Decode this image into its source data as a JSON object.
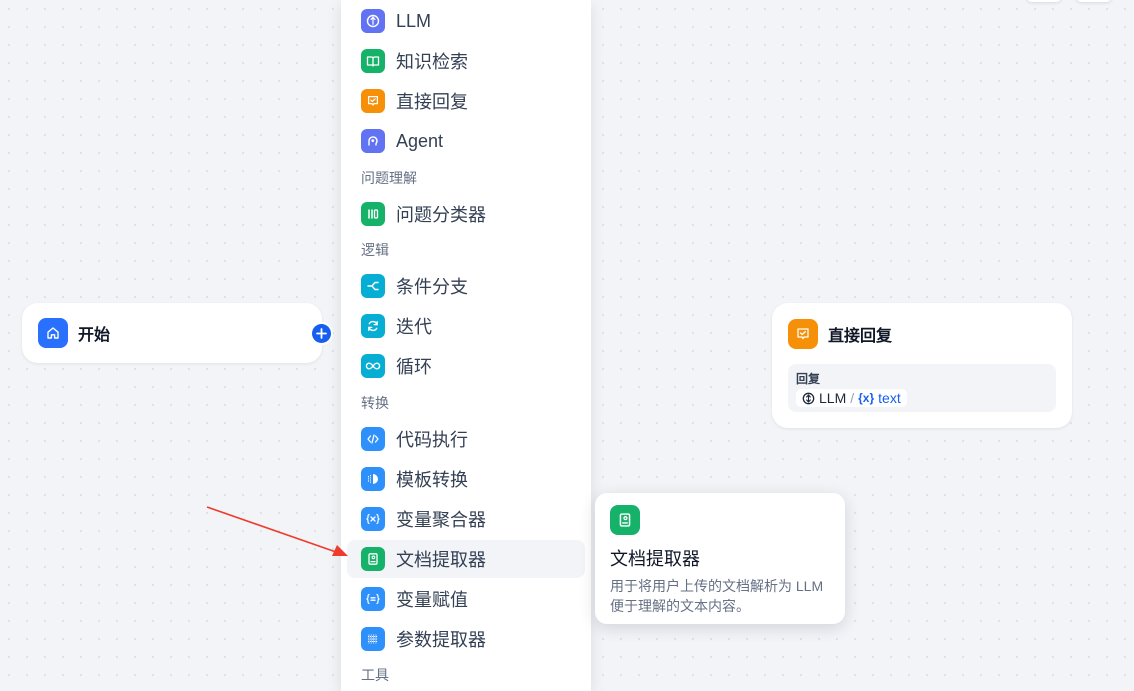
{
  "start_node": {
    "title": "开始",
    "icon": "home-icon",
    "color": "#2970ff"
  },
  "answer_node": {
    "title": "直接回复",
    "icon": "chat-check-icon",
    "color": "#f79009",
    "field_label": "回复",
    "var_source": "LLM",
    "var_separator": "/",
    "var_brace": "{x}",
    "var_name": "text"
  },
  "block_menu": {
    "items_top": [
      {
        "label": "LLM",
        "icon": "llm-icon",
        "color": "#6172f3"
      },
      {
        "label": "知识检索",
        "icon": "book-icon",
        "color": "#17b26a"
      },
      {
        "label": "直接回复",
        "icon": "chat-check-icon",
        "color": "#f79009"
      },
      {
        "label": "Agent",
        "icon": "agent-icon",
        "color": "#6172f3"
      }
    ],
    "group_question": "问题理解",
    "items_question": [
      {
        "label": "问题分类器",
        "icon": "classifier-icon",
        "color": "#17b26a"
      }
    ],
    "group_logic": "逻辑",
    "items_logic": [
      {
        "label": "条件分支",
        "icon": "branch-icon",
        "color": "#06aed4"
      },
      {
        "label": "迭代",
        "icon": "iteration-icon",
        "color": "#06aed4"
      },
      {
        "label": "循环",
        "icon": "loop-icon",
        "color": "#06aed4"
      }
    ],
    "group_transform": "转换",
    "items_transform": [
      {
        "label": "代码执行",
        "icon": "code-icon",
        "color": "#2e90fa"
      },
      {
        "label": "模板转换",
        "icon": "template-icon",
        "color": "#2e90fa"
      },
      {
        "label": "变量聚合器",
        "icon": "variable-icon",
        "color": "#2e90fa"
      },
      {
        "label": "文档提取器",
        "icon": "doc-extractor-icon",
        "color": "#17b26a"
      },
      {
        "label": "变量赋值",
        "icon": "assign-icon",
        "color": "#2e90fa"
      },
      {
        "label": "参数提取器",
        "icon": "param-extractor-icon",
        "color": "#2e90fa"
      }
    ],
    "group_tools": "工具"
  },
  "tooltip": {
    "title": "文档提取器",
    "description": "用于将用户上传的文档解析为 LLM 便于理解的文本内容。",
    "icon": "doc-extractor-icon",
    "color": "#17b26a"
  },
  "annotation": {
    "arrow_color": "#ef3b2d"
  }
}
